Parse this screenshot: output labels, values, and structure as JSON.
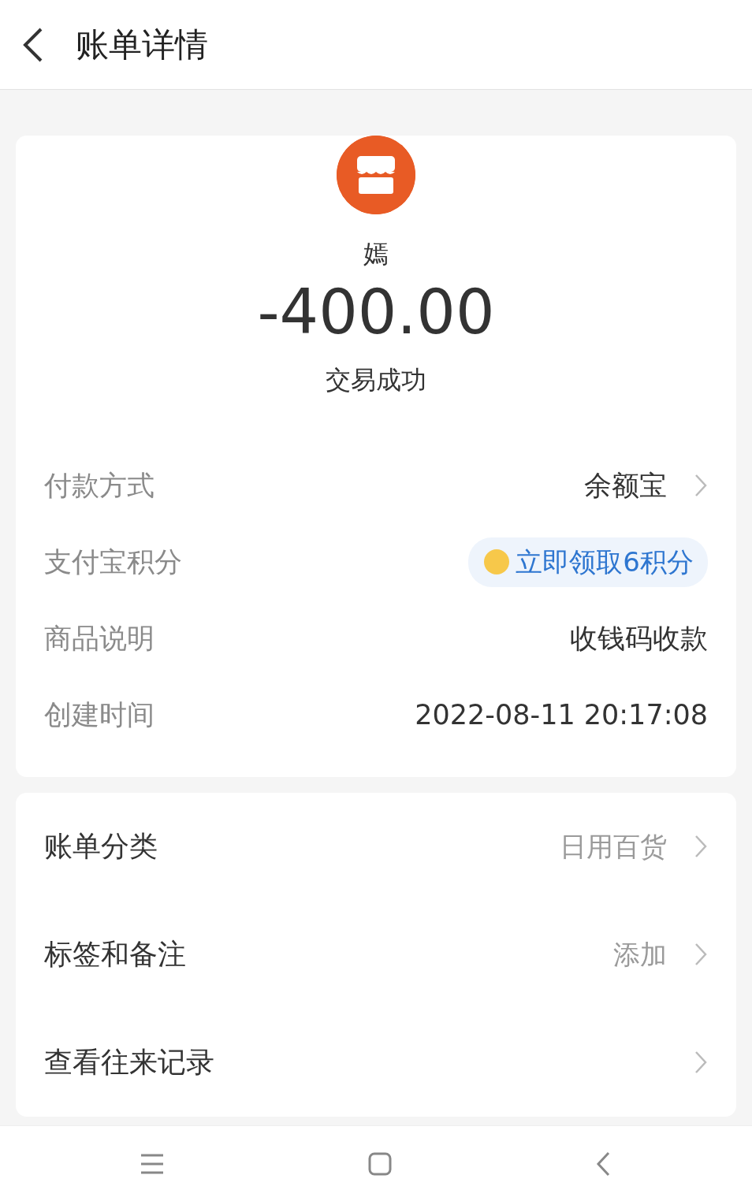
{
  "header": {
    "title": "账单详情"
  },
  "summary": {
    "merchant": "嫣",
    "amount": "-400.00",
    "status": "交易成功"
  },
  "details": [
    {
      "label": "付款方式",
      "value": "余额宝",
      "kind": "link"
    },
    {
      "label": "支付宝积分",
      "value": "立即领取6积分",
      "kind": "points"
    },
    {
      "label": "商品说明",
      "value": "收钱码收款",
      "kind": "text"
    },
    {
      "label": "创建时间",
      "value": "2022-08-11 20:17:08",
      "kind": "text"
    }
  ],
  "actions": [
    {
      "label": "账单分类",
      "value": "日用百货"
    },
    {
      "label": "标签和备注",
      "value": "添加"
    },
    {
      "label": "查看往来记录"
    }
  ]
}
